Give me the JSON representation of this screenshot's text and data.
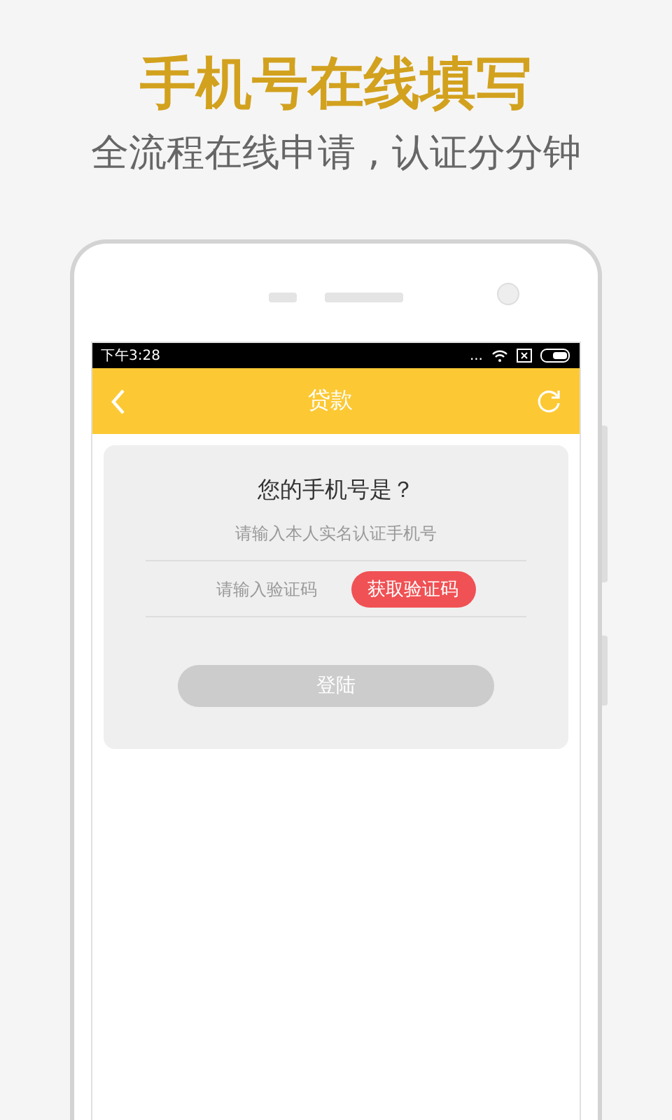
{
  "headline": "手机号在线填写",
  "subheadline": "全流程在线申请 , 认证分分钟",
  "status_bar": {
    "time": "下午3:28",
    "dots": "..."
  },
  "nav": {
    "title": "贷款"
  },
  "form": {
    "question": "您的手机号是？",
    "phone_field": {
      "placeholder": "请输入本人实名认证手机号"
    },
    "code_field": {
      "placeholder": "请输入验证码"
    },
    "code_button": "获取验证码",
    "login_button": {
      "label": "登陆",
      "disabled": true
    }
  }
}
